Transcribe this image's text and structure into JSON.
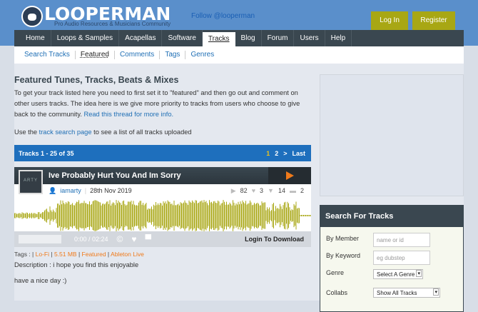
{
  "header": {
    "logo_text": "LOOPERMAN",
    "tagline": "Pro Audio Resources & Musicians Community",
    "follow": "Follow @looperman",
    "login": "Log In",
    "register": "Register",
    "accent": "#a8a714"
  },
  "nav": {
    "items": [
      "Home",
      "Loops & Samples",
      "Acapellas",
      "Software",
      "Tracks",
      "Blog",
      "Forum",
      "Users",
      "Help"
    ],
    "active": "Tracks"
  },
  "subnav": {
    "items": [
      "Search Tracks",
      "Featured",
      "Comments",
      "Tags",
      "Genres"
    ],
    "active": "Featured"
  },
  "main": {
    "title": "Featured Tunes, Tracks, Beats & Mixes",
    "intro": "To get your track listed here you need to first set it to \"featured\" and then go out and comment on other users tracks. The idea here is we give more priority to tracks from users who choose to give back to the community.",
    "intro_link": "Read this thread for more info.",
    "use_pre": "Use the ",
    "use_link": "track search page",
    "use_post": " to see a list of all tracks uploaded",
    "pager": {
      "label": "Tracks 1 - 25 of 35",
      "pages": [
        "1",
        "2",
        ">",
        "Last"
      ],
      "current": "1"
    },
    "track": {
      "title": "Ive Probably Hurt You And Im Sorry",
      "art_text": "ARTY",
      "user": "iamarty",
      "date": "28th Nov 2019",
      "plays": "82",
      "likes": "3",
      "downloads": "14",
      "comments": "2",
      "time": "0:00 / 02:24",
      "download": "Login To Download",
      "waveform_color": "#a8a714",
      "tags_label": "Tags :",
      "tags": [
        "Lo-Fi",
        "5.51 MB",
        "Featured",
        "Ableton Live"
      ],
      "description": "Description : i hope you find this enjoyable",
      "description2": "have a nice day :)"
    }
  },
  "search": {
    "title": "Search For Tracks",
    "member_label": "By Member",
    "member_placeholder": "name or id",
    "keyword_label": "By Keyword",
    "keyword_placeholder": "eg dubstep",
    "genre_label": "Genre",
    "genre_value": "Select A Genre",
    "collabs_label": "Collabs",
    "collabs_value": "Show All Tracks"
  }
}
